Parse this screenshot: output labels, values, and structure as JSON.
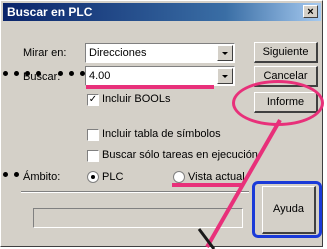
{
  "window": {
    "title": "Buscar en PLC",
    "close_glyph": "×"
  },
  "search_in": {
    "label": "Mirar en:",
    "value": "Direcciones"
  },
  "search_for": {
    "label": "Buscar:",
    "value": "4.00"
  },
  "options": {
    "include_bools": {
      "label": "Incluir BOOLs",
      "checked": true
    },
    "include_symbols": {
      "label": "Incluir tabla de símbolos",
      "checked": false
    },
    "running_tasks_only": {
      "label": "Buscar sólo tareas en ejecución",
      "checked": false
    }
  },
  "scope": {
    "label": "Ámbito:",
    "options": [
      {
        "label": "PLC",
        "selected": true
      },
      {
        "label": "Vista actual",
        "selected": false
      }
    ]
  },
  "buttons": {
    "next": "Siguiente",
    "cancel": "Cancelar",
    "report": "Informe",
    "help": "Ayuda"
  },
  "annotation_colors": {
    "highlight": "#e8307a",
    "help_box": "#1a3ad8"
  }
}
